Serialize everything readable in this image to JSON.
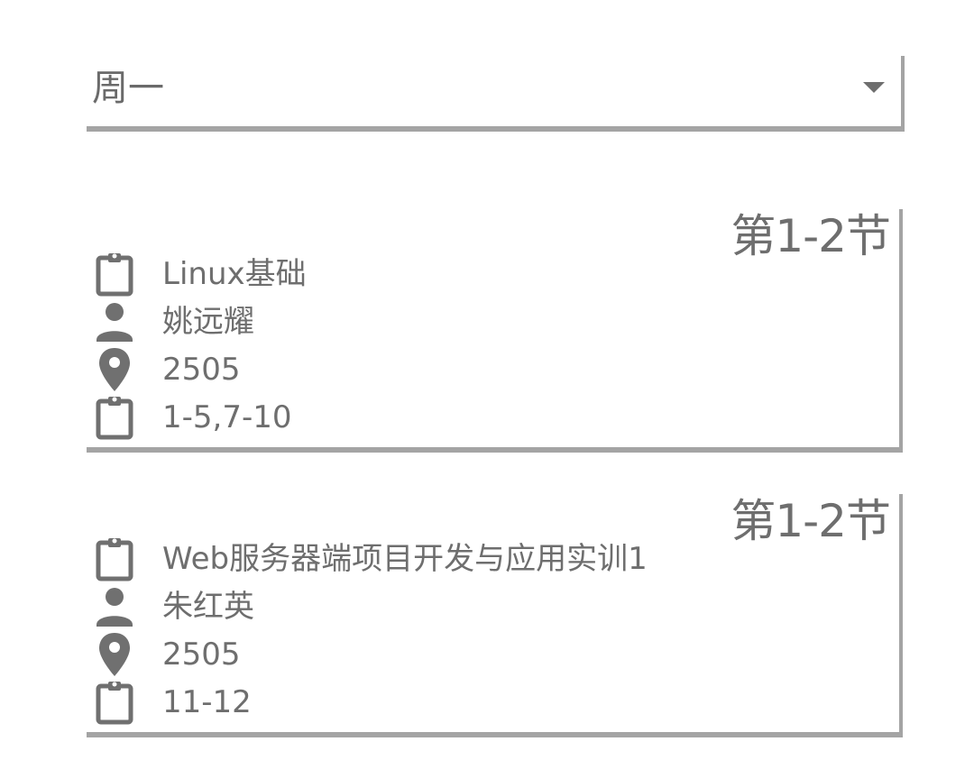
{
  "day_selector": {
    "value": "周一",
    "caret_icon": "dropdown-caret-icon"
  },
  "courses": [
    {
      "period": "第1-2节",
      "name": "Linux基础",
      "teacher": "姚远耀",
      "room": "2505",
      "weeks": "1-5,7-10"
    },
    {
      "period": "第1-2节",
      "name": "Web服务器端项目开发与应用实训1",
      "teacher": "朱红英",
      "room": "2505",
      "weeks": "11-12"
    }
  ],
  "icons": {
    "course": "clipboard-icon",
    "teacher": "person-icon",
    "room": "location-pin-icon",
    "weeks": "clipboard-icon"
  },
  "colors": {
    "text": "#6e6e6e",
    "shadow": "#a4a4a4",
    "background": "#ffffff"
  }
}
